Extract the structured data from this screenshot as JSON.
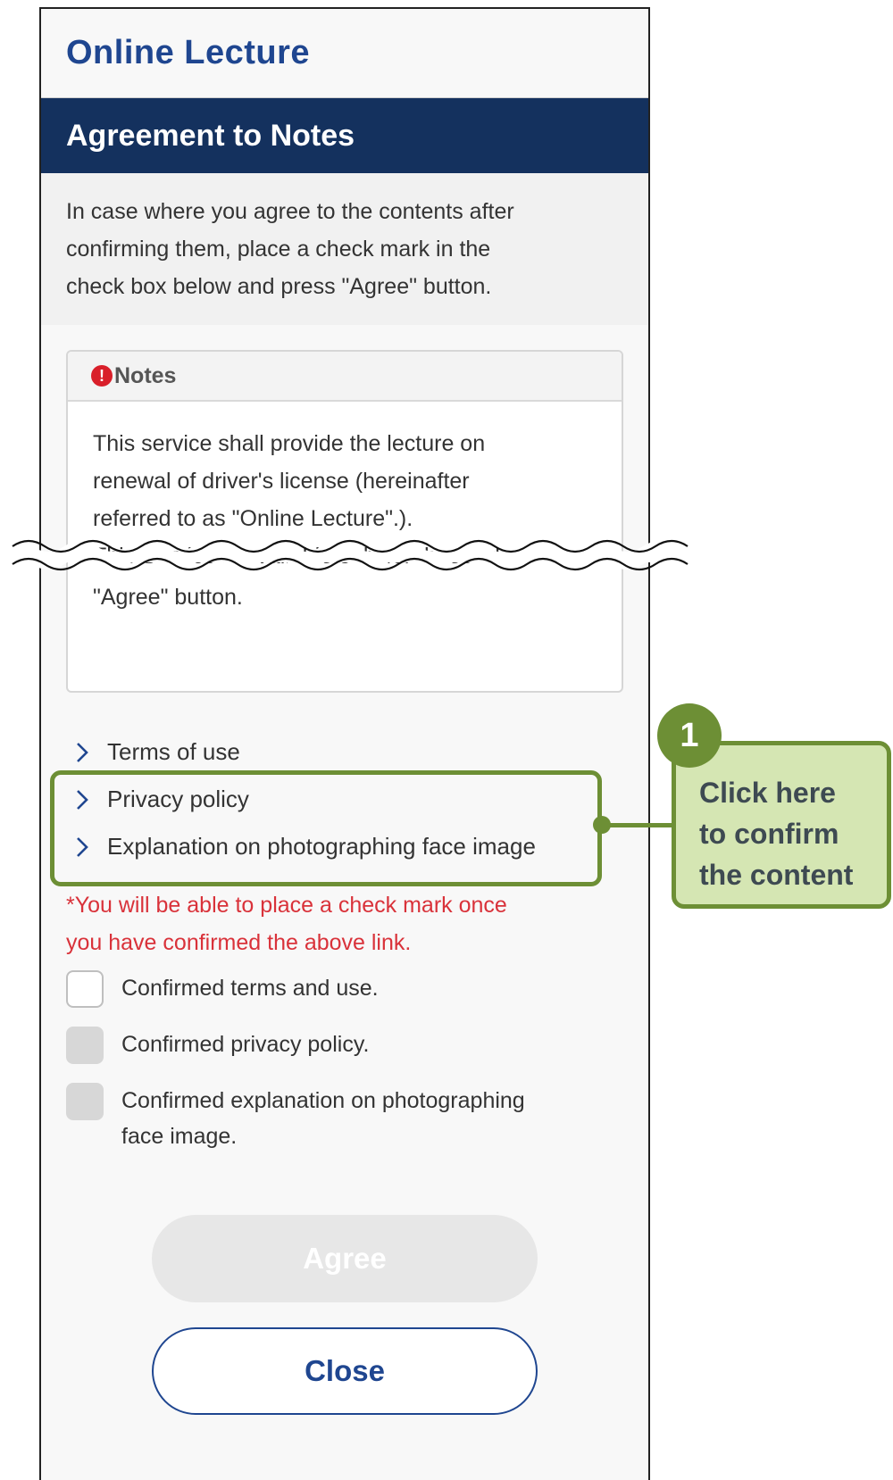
{
  "app": {
    "title": "Online Lecture"
  },
  "section": {
    "title": "Agreement to Notes"
  },
  "intro": {
    "lines": [
      "In case where you agree to the contents after",
      "confirming them, place a check mark in the",
      "check box below and press \"Agree\" button."
    ]
  },
  "notes": {
    "title": "Notes",
    "icon": "alert-circle-icon",
    "lines": [
      "This service shall provide the lecture on",
      "renewal of driver's license (hereinafter",
      "referred to as \"Online Lecture\".).",
      "This Service is available only for those who"
    ],
    "last_line": "\"Agree\" button."
  },
  "links": [
    {
      "label": "Terms of use"
    },
    {
      "label": "Privacy policy"
    },
    {
      "label": "Explanation on photographing face image"
    }
  ],
  "warning": {
    "lines": [
      "*You will be able to place a check mark once",
      "you have confirmed the above link."
    ]
  },
  "checks": [
    {
      "lines": [
        "Confirmed terms and use."
      ],
      "enabled": true
    },
    {
      "lines": [
        "Confirmed privacy policy."
      ],
      "enabled": false
    },
    {
      "lines": [
        "Confirmed explanation on photographing",
        "face image."
      ],
      "enabled": false
    }
  ],
  "buttons": {
    "agree": "Agree",
    "close": "Close"
  },
  "callout": {
    "step": "1",
    "lines": [
      "Click here",
      "to confirm",
      "the content"
    ]
  },
  "colors": {
    "brand_blue": "#1f4690",
    "header_navy": "#14315e",
    "warning_red": "#d9323a",
    "callout_green": "#6d8f35",
    "callout_fill": "#d5e6b3"
  }
}
